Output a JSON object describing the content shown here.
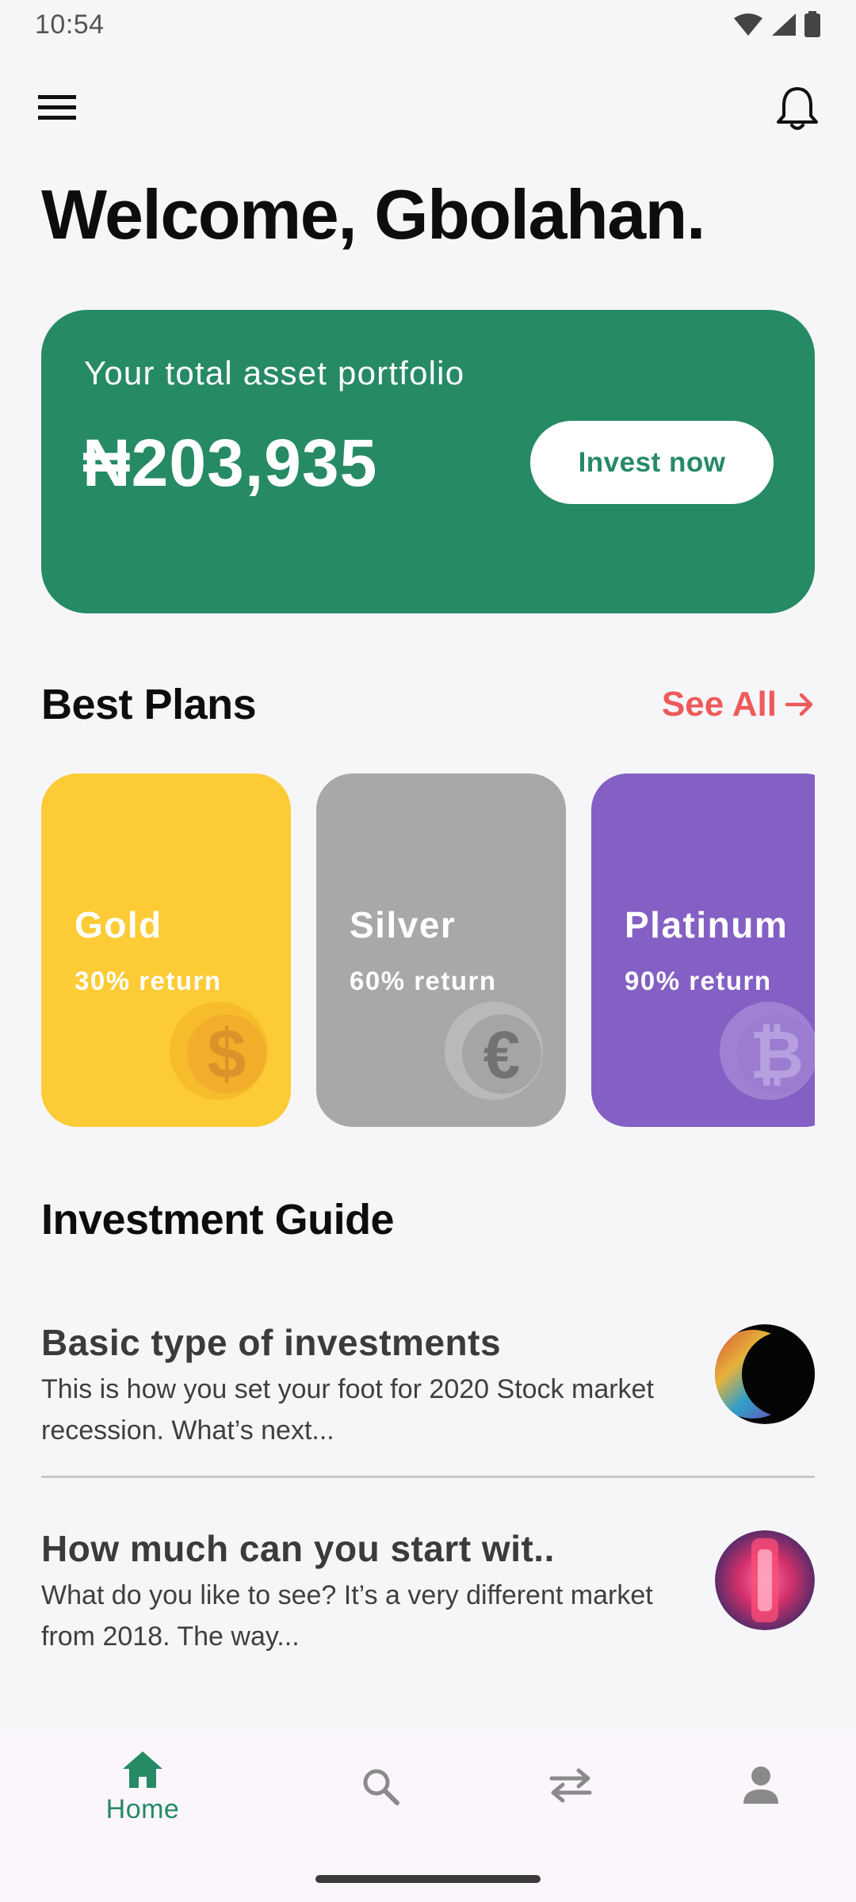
{
  "status_bar": {
    "time": "10:54"
  },
  "header": {
    "welcome": "Welcome, Gbolahan."
  },
  "portfolio": {
    "label": "Your total asset portfolio",
    "amount": "₦203,935",
    "invest_label": "Invest now",
    "card_color": "#268a65"
  },
  "plans_section": {
    "title": "Best Plans",
    "see_all": "See All",
    "plans": [
      {
        "name": "Gold",
        "return": "30% return",
        "color": "#fdcb35",
        "icon": "dollar-coin-icon"
      },
      {
        "name": "Silver",
        "return": "60% return",
        "color": "#a8a8a8",
        "icon": "euro-coin-icon"
      },
      {
        "name": "Platinum",
        "return": "90% return",
        "color": "#8460c4",
        "icon": "bitcoin-coin-icon"
      }
    ]
  },
  "guide_section": {
    "title": "Investment Guide",
    "items": [
      {
        "title": "Basic type of investments",
        "description": "This is how you set your foot for 2020 Stock market recession. What’s next..."
      },
      {
        "title": "How much can you start wit..",
        "description": "What do you like to see? It’s a very different market from 2018. The way..."
      }
    ]
  },
  "bottom_nav": {
    "active_color": "#268a65",
    "items": [
      {
        "label": "Home",
        "icon": "home-icon",
        "active": true
      },
      {
        "label": "",
        "icon": "search-icon",
        "active": false
      },
      {
        "label": "",
        "icon": "transfer-icon",
        "active": false
      },
      {
        "label": "",
        "icon": "profile-icon",
        "active": false
      }
    ]
  }
}
